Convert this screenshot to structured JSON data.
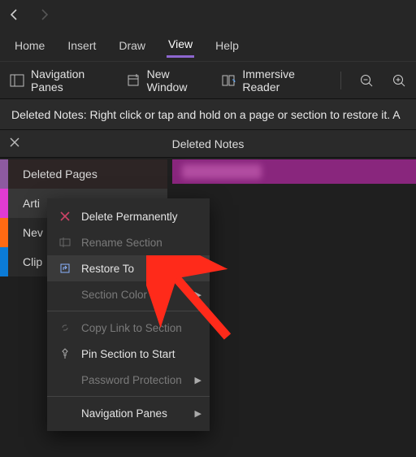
{
  "nav": {
    "back": "Back",
    "forward": "Forward"
  },
  "menu": {
    "home": "Home",
    "insert": "Insert",
    "draw": "Draw",
    "view": "View",
    "help": "Help"
  },
  "ribbon": {
    "navpanes": "Navigation Panes",
    "newwindow": "New Window",
    "immersive": "Immersive Reader"
  },
  "infobar": "Deleted Notes: Right click or tap and hold on a page or section to restore it. A",
  "panel": {
    "title": "Deleted Notes",
    "close": "Close"
  },
  "sidebar": {
    "header": "Deleted Pages",
    "items": [
      "Arti",
      "Nev",
      "Clip"
    ]
  },
  "ctx": {
    "delete": "Delete Permanently",
    "rename": "Rename Section",
    "restore": "Restore To",
    "color": "Section Color",
    "copylink": "Copy Link to Section",
    "pin": "Pin Section to Start",
    "password": "Password Protection",
    "navpanes": "Navigation Panes"
  }
}
